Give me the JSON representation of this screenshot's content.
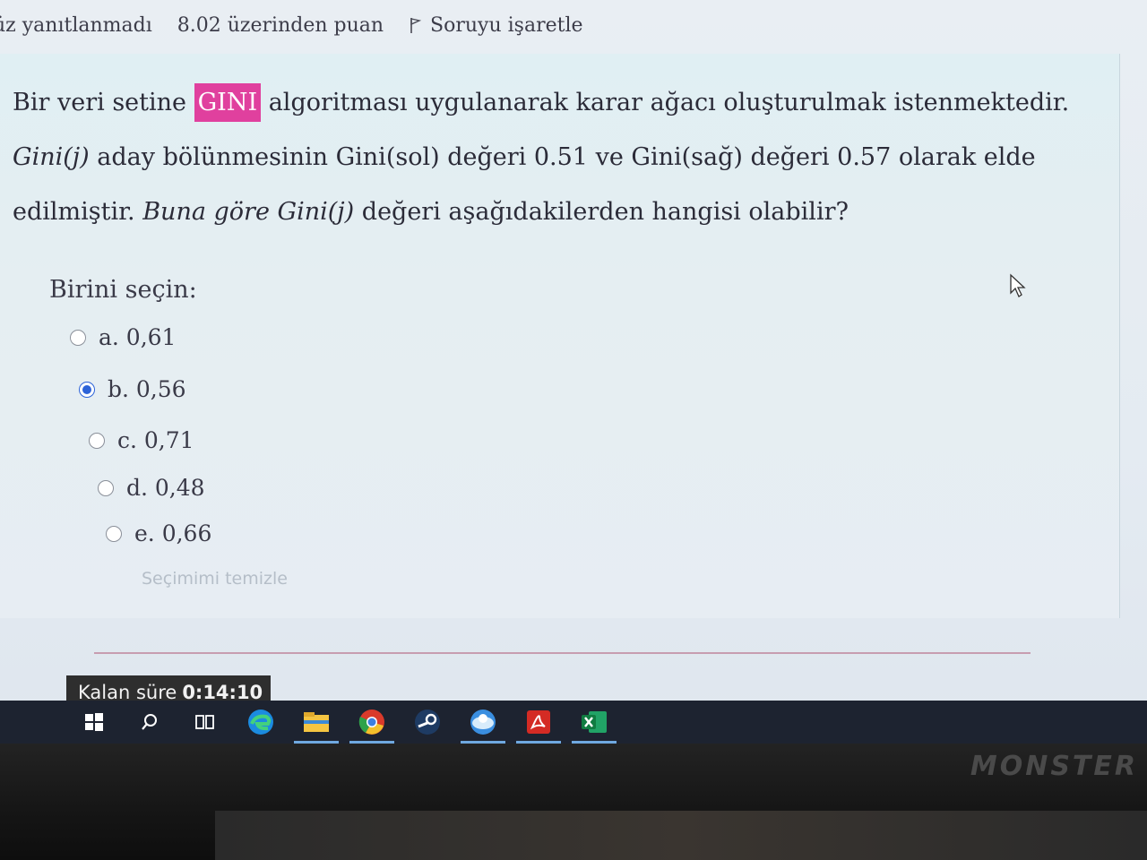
{
  "header": {
    "status": "üz yanıtlanmadı",
    "grade": "8.02 üzerinden puan",
    "flag_label": "Soruyu işaretle"
  },
  "question": {
    "part1": "Bir veri setine ",
    "highlight": "GINI",
    "part2": " algoritması uygulanarak karar ağacı oluşturulmak istenmektedir. ",
    "part3": "Gini(j)",
    "part4": " aday bölünmesinin Gini(sol) değeri 0.51 ve Gini(sağ) değeri 0.57 olarak elde edilmiştir. ",
    "part5": "Buna göre Gini(j)",
    "part6": " değeri aşağıdakilerden hangisi olabilir?"
  },
  "answer": {
    "prompt": "Birini seçin:",
    "options": [
      {
        "label": "a. 0,61",
        "checked": false
      },
      {
        "label": "b. 0,56",
        "checked": true
      },
      {
        "label": "c. 0,71",
        "checked": false
      },
      {
        "label": "d. 0,48",
        "checked": false
      },
      {
        "label": "e. 0,66",
        "checked": false
      }
    ],
    "clear_label": "Seçimimi temizle"
  },
  "timer": {
    "label": "Kalan süre",
    "value": "0:14:10"
  },
  "taskbar": {
    "items": [
      "windows-start",
      "search",
      "task-view",
      "edge",
      "file-explorer",
      "chrome",
      "steam",
      "browser",
      "acrobat",
      "excel"
    ]
  },
  "monitor": {
    "brand": "MONSTER"
  },
  "colors": {
    "highlight": "#e0409e",
    "radio_checked": "#2d63d8",
    "taskbar": "#1d2330"
  }
}
